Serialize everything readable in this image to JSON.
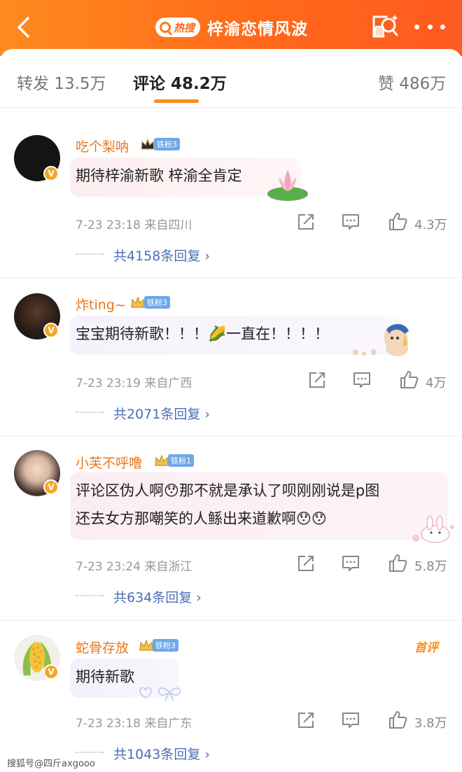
{
  "header": {
    "hot_label": "热搜",
    "title": "梓渝恋情风波"
  },
  "tabs": {
    "repost": "转发 13.5万",
    "comments": "评论 48.2万",
    "likes": "赞 486万"
  },
  "comments": [
    {
      "username": "吃个梨呐",
      "fan_level": "铁粉3",
      "lines": [
        "期待梓渝新歌 梓渝全肯定"
      ],
      "meta": "7-23 23:18  来自四川",
      "likes": "4.3万",
      "replies": "共4158条回复 ›"
    },
    {
      "username": "炸ting~",
      "fan_level": "铁粉3",
      "lines": [
        "宝宝期待新歌！！！🌽一直在！！！！"
      ],
      "meta": "7-23 23:19  来自广西",
      "likes": "4万",
      "replies": "共2071条回复 ›"
    },
    {
      "username": "小芙不呼噜",
      "fan_level": "铁粉1",
      "lines": [
        "评论区伪人啊😯那不就是承认了呗刚刚说是p图",
        "还去女方那嘲笑的人鲧出来道歉啊😯😯"
      ],
      "meta": "7-23 23:24  来自浙江",
      "likes": "5.8万",
      "replies": "共634条回复 ›"
    },
    {
      "username": "蛇骨存放",
      "fan_level": "铁粉3",
      "first_tag": "首评",
      "lines": [
        "期待新歌"
      ],
      "meta": "7-23 23:18  来自广东",
      "likes": "3.8万",
      "replies": "共1043条回复 ›"
    }
  ],
  "watermark": "搜狐号@四斤axgooo"
}
